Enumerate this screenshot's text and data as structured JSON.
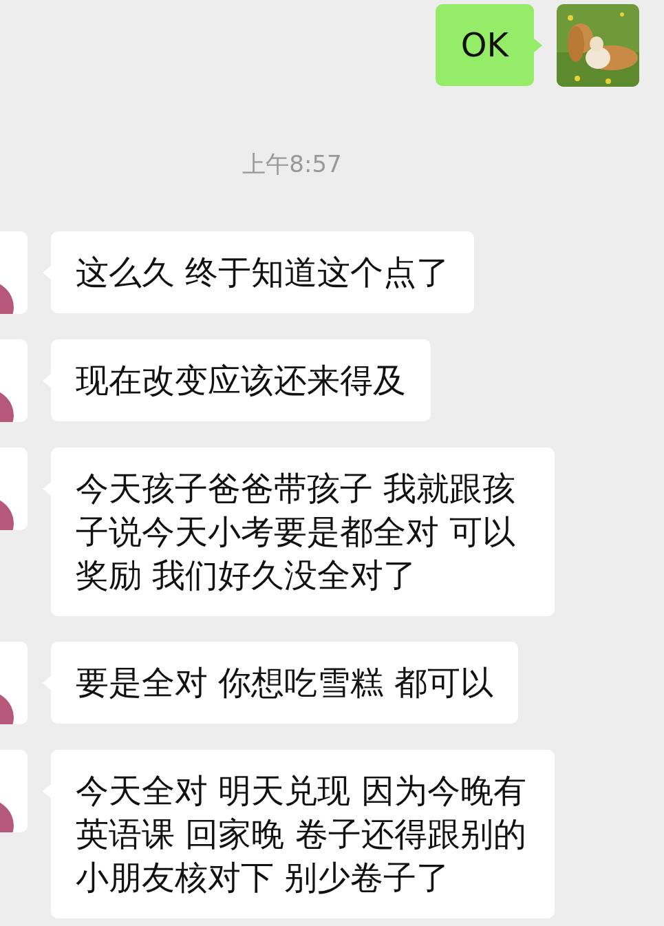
{
  "messages": [
    {
      "kind": "sent",
      "text": "OK"
    },
    {
      "kind": "time",
      "text": "上午8:57"
    },
    {
      "kind": "received",
      "text": "这么久 终于知道这个点了"
    },
    {
      "kind": "received",
      "text": "现在改变应该还来得及"
    },
    {
      "kind": "received",
      "text": "今天孩子爸爸带孩子 我就跟孩子说今天小考要是都全对 可以奖励 我们好久没全对了"
    },
    {
      "kind": "received",
      "text": "要是全对 你想吃雪糕 都可以"
    },
    {
      "kind": "received",
      "text": "今天全对 明天兑现 因为今晚有英语课 回家晚 卷子还得跟别的小朋友核对下 别少卷子了"
    }
  ]
}
